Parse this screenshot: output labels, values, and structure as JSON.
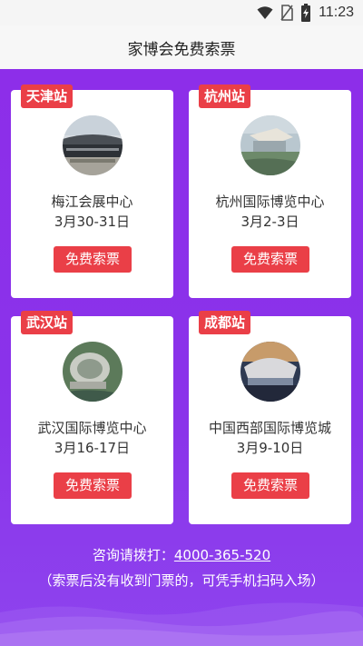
{
  "status_bar": {
    "time": "11:23"
  },
  "header": {
    "title": "家博会免费索票"
  },
  "cards": [
    {
      "city": "天津站",
      "venue": "梅江会展中心",
      "date": "3月30-31日",
      "button": "免费索票",
      "photo_icon": "venue-photo-tianjin"
    },
    {
      "city": "杭州站",
      "venue": "杭州国际博览中心",
      "date": "3月2-3日",
      "button": "免费索票",
      "photo_icon": "venue-photo-hangzhou"
    },
    {
      "city": "武汉站",
      "venue": "武汉国际博览中心",
      "date": "3月16-17日",
      "button": "免费索票",
      "photo_icon": "venue-photo-wuhan"
    },
    {
      "city": "成都站",
      "venue": "中国西部国际博览城",
      "date": "3月9-10日",
      "button": "免费索票",
      "photo_icon": "venue-photo-chengdu"
    }
  ],
  "footer": {
    "hotline_label": "咨询请拨打：",
    "hotline_number": "4000-365-520",
    "note": "（索票后没有收到门票的，可凭手机扫码入场）"
  },
  "colors": {
    "primary": "#8b2fe8",
    "accent": "#ea3f47"
  }
}
